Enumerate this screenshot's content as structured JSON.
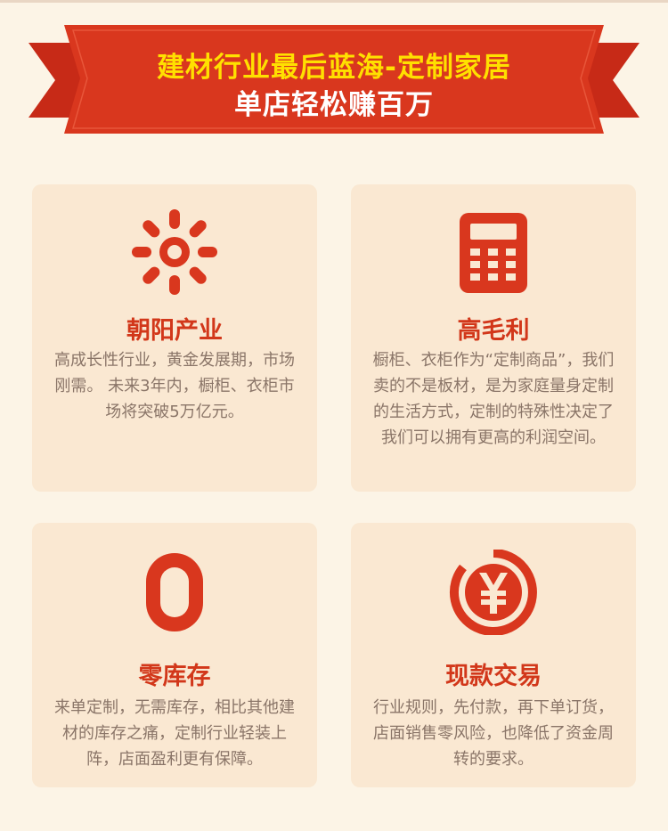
{
  "banner": {
    "line1": "建材行业最后蓝海-定制家居",
    "line2": "单店轻松赚百万",
    "colors": {
      "ribbon": "#d6321c",
      "ribbon_dark": "#a82312",
      "highlight": "#ffe000"
    }
  },
  "cards": [
    {
      "icon": "sun-icon",
      "title": "朝阳产业",
      "desc": "高成长性行业，黄金发展期，市场刚需。 未来3年内，橱柜、衣柜市场将突破5万亿元。"
    },
    {
      "icon": "calculator-icon",
      "title": "高毛利",
      "desc": "橱柜、衣柜作为“定制商品”，我们卖的不是板材，是为家庭量身定制的生活方式，定制的特殊性决定了我们可以拥有更高的利润空间。"
    },
    {
      "icon": "zero-icon",
      "title": "零库存",
      "desc": "来单定制，无需库存，相比其他建材的库存之痛，定制行业轻装上阵，店面盈利更有保障。"
    },
    {
      "icon": "yen-coin-icon",
      "title": "现款交易",
      "desc": "行业规则，先付款，再下单订货，店面销售零风险，也降低了资金周转的要求。"
    }
  ],
  "colors": {
    "accent": "#d2371a",
    "card_bg": "#fae8d2",
    "page_bg": "#fcf4e6",
    "text": "#8a7568"
  }
}
